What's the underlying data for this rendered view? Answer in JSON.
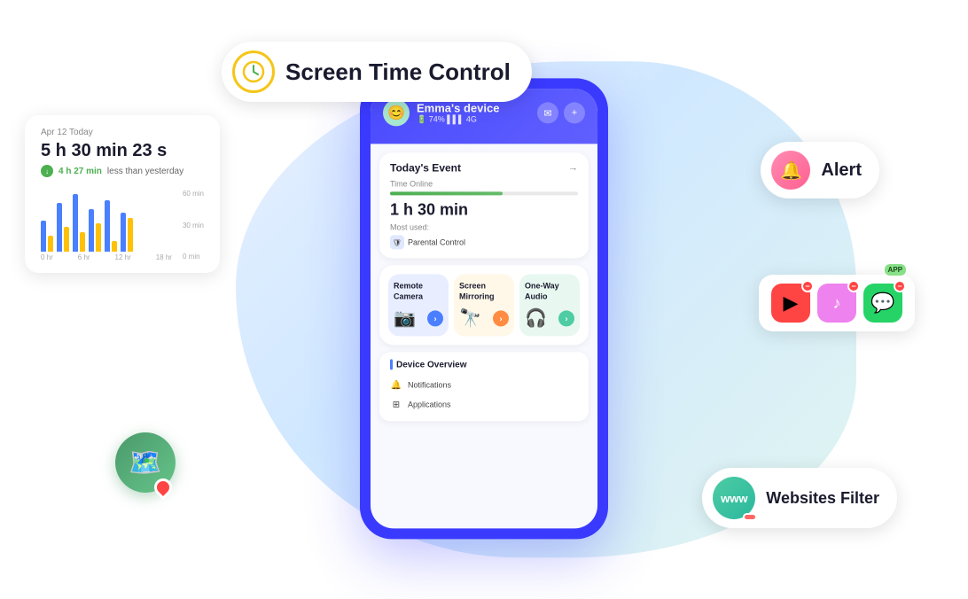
{
  "screen_time": {
    "title": "Screen Time Control",
    "icon_label": "clock-icon"
  },
  "stats": {
    "date": "Apr 12 Today",
    "time": "5 h 30 min 23 s",
    "diff_value": "4 h 27 min",
    "diff_text": "less than yesterday",
    "chart": {
      "x_labels": [
        "0 hr",
        "6 hr",
        "12 hr",
        "18 hr"
      ],
      "y_labels": [
        "60 min",
        "30 min",
        "0 min"
      ],
      "bars": [
        {
          "blue": 30,
          "yellow": 15
        },
        {
          "blue": 50,
          "yellow": 25
        },
        {
          "blue": 60,
          "yellow": 20
        },
        {
          "blue": 45,
          "yellow": 30
        },
        {
          "blue": 55,
          "yellow": 10
        },
        {
          "blue": 40,
          "yellow": 35
        }
      ]
    }
  },
  "alert": {
    "text": "Alert",
    "icon": "bell-icon"
  },
  "phone": {
    "device_name": "Emma's device",
    "battery": "74%",
    "signal": "4G",
    "header": {
      "msg_icon": "message-icon",
      "add_icon": "plus-icon"
    },
    "today_event": {
      "title": "Today's Event",
      "label": "Time Online",
      "time": "1 h 30 min",
      "most_used": "Most used:",
      "app": "Parental Control",
      "progress": 60
    },
    "features": [
      {
        "name": "Remote\nCamera",
        "emoji": "📷",
        "bg": "blue"
      },
      {
        "name": "Screen\nMirroring",
        "emoji": "🔭",
        "bg": "yellow"
      },
      {
        "name": "One-Way\nAudio",
        "emoji": "🎧",
        "bg": "green"
      }
    ],
    "device_overview": {
      "title": "Device Overview",
      "items": [
        "Notifications",
        "Applications"
      ]
    }
  },
  "apps": {
    "label": "APP",
    "items": [
      "YouTube",
      "TikTok",
      "WhatsApp"
    ]
  },
  "location": {
    "icon": "map-icon"
  },
  "websites": {
    "text": "Websites Filter",
    "icon_text": "www"
  }
}
